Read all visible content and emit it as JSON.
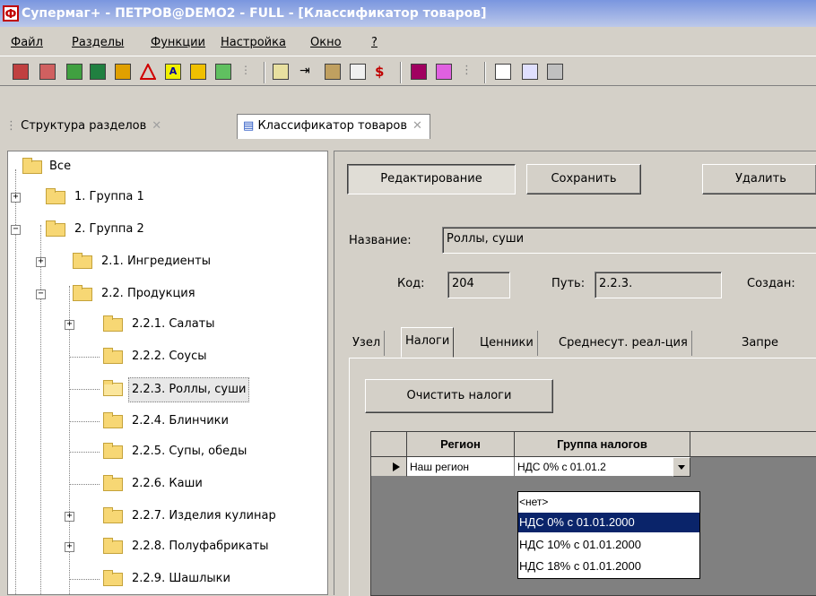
{
  "window": {
    "title": "Супермаг+ - ПЕТРОВ@DEMO2 - FULL  - [Классификатор товаров]"
  },
  "menu": [
    "Файл",
    "Разделы",
    "Функции",
    "Настройка",
    "Окно",
    "?"
  ],
  "toolbar_icons": [
    "report-icon",
    "report2-icon",
    "money-doc-icon",
    "table-doc-icon",
    "calc-doc-icon",
    "triangle-icon",
    "text-a-icon",
    "percent-icon",
    "edit-icon",
    "tree-icon",
    "doc-list-icon",
    "arrows-icon",
    "pen-icon",
    "write-icon",
    "dollar-icon",
    "truck-icon",
    "branch-icon",
    "tree2-icon",
    "copy-icon",
    "grid-icon",
    "columns-icon"
  ],
  "doc_tabs": {
    "tab1": "Структура разделов",
    "tab2": "Классификатор товаров"
  },
  "tree": {
    "items": [
      {
        "label": "Все"
      },
      {
        "label": "1. Группа 1"
      },
      {
        "label": "2. Группа 2"
      },
      {
        "label": "2.1. Ингредиенты"
      },
      {
        "label": "2.2. Продукция"
      },
      {
        "label": "2.2.1. Салаты"
      },
      {
        "label": "2.2.2. Соусы"
      },
      {
        "label": "2.2.3. Роллы, суши"
      },
      {
        "label": "2.2.4. Блинчики"
      },
      {
        "label": "2.2.5. Супы, обеды"
      },
      {
        "label": "2.2.6. Каши"
      },
      {
        "label": "2.2.7. Изделия кулинар"
      },
      {
        "label": "2.2.8. Полуфабрикаты"
      },
      {
        "label": "2.2.9. Шашлыки"
      }
    ]
  },
  "actions": {
    "edit": "Редактирование",
    "save": "Сохранить",
    "delete": "Удалить"
  },
  "form": {
    "name_label": "Название:",
    "name_value": "Роллы, суши",
    "code_label": "Код:",
    "code_value": "204",
    "path_label": "Путь:",
    "path_value": "2.2.3.",
    "created_label": "Создан:"
  },
  "inner_tabs": [
    "Узел",
    "Налоги",
    "Ценники",
    "Среднесут. реал-ция",
    "Запре"
  ],
  "clear_taxes": "Очистить налоги",
  "grid": {
    "columns": [
      "Регион",
      "Группа налогов"
    ],
    "rows": [
      {
        "region": "Наш регион",
        "tax_group": "НДС 0% с 01.01.2"
      }
    ]
  },
  "dropdown": {
    "options": [
      "<нет>",
      "НДС 0% с 01.01.2000",
      "НДС 10% с 01.01.2000",
      "НДС 18% с 01.01.2000"
    ],
    "selected": "НДС 0% с 01.01.2000"
  }
}
